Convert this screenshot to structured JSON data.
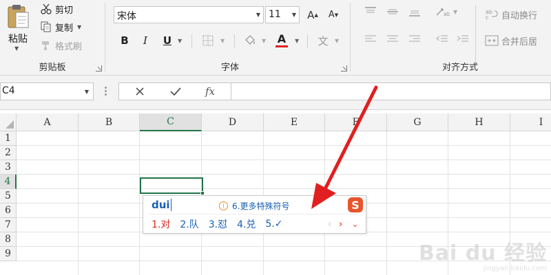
{
  "ribbon": {
    "clipboard": {
      "paste_label": "粘贴",
      "cut_label": "剪切",
      "copy_label": "复制",
      "format_painter_label": "格式刷",
      "group_label": "剪贴板"
    },
    "font": {
      "font_name": "宋体",
      "font_size": "11",
      "grow_label": "A",
      "shrink_label": "A",
      "bold_label": "B",
      "italic_label": "I",
      "underline_label": "U",
      "font_color_label": "A",
      "phonetic_label": "文",
      "group_label": "字体",
      "font_color": "#e02020"
    },
    "alignment": {
      "wrap_text_label": "自动换行",
      "merge_center_label": "合并后居",
      "group_label": "对齐方式"
    }
  },
  "formula_bar": {
    "name_box": "C4",
    "fx_label": "fx",
    "formula_value": ""
  },
  "grid": {
    "columns": [
      "A",
      "B",
      "C",
      "D",
      "E",
      "F",
      "G",
      "H",
      "I"
    ],
    "rows": [
      "1",
      "2",
      "3",
      "4",
      "5",
      "6",
      "7",
      "8",
      "9"
    ],
    "active_column": "C",
    "active_row": "4",
    "accent_color": "#217346"
  },
  "ime": {
    "pinyin": "dui",
    "hint_text": "6.更多特殊符号",
    "hint_icon": "info-icon",
    "logo_text": "S",
    "candidates": [
      "1.对",
      "2.队",
      "3.怼",
      "4.兑",
      "5.✓"
    ],
    "prev_icon": "chevron-left-icon",
    "next_icon": "chevron-right-icon",
    "more_icon": "chevron-down-icon",
    "brand_color": "#e8542c"
  },
  "annotation": {
    "arrow_color": "#e02020"
  },
  "watermark": {
    "main": "Bai du 经验",
    "sub": "jingyan.baidu.com"
  }
}
